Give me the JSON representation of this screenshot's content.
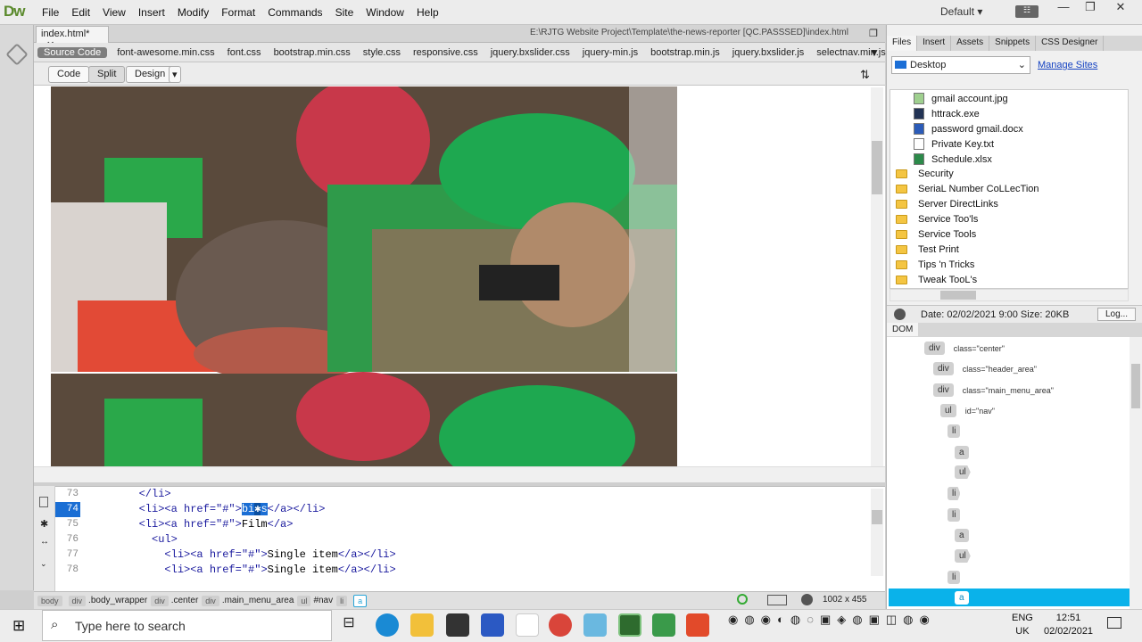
{
  "app": {
    "logo": "Dw",
    "workspace": "Default"
  },
  "menu": [
    "File",
    "Edit",
    "View",
    "Insert",
    "Modify",
    "Format",
    "Commands",
    "Site",
    "Window",
    "Help"
  ],
  "document": {
    "tab": "index.html*",
    "path": "E:\\RJTG Website Project\\Template\\the-news-reporter [QC.PASSSED]\\index.html"
  },
  "related_files": [
    "Source Code",
    "font-awesome.min.css",
    "font.css",
    "bootstrap.min.css",
    "style.css",
    "responsive.css",
    "jquery.bxslider.css",
    "jquery-min.js",
    "bootstrap.min.js",
    "jquery.bxslider.js",
    "selectnav.min.js"
  ],
  "view_buttons": {
    "code": "Code",
    "split": "Split",
    "design": "Design"
  },
  "code": {
    "line_numbers": [
      "73",
      "74",
      "75",
      "76",
      "77",
      "78"
    ],
    "lines": [
      {
        "indent": "        ",
        "text": "</li>"
      },
      {
        "indent": "        ",
        "pre": "<li><a href=\"#\">",
        "hl": "bi",
        "hl2": "s",
        "post": "</a></li>"
      },
      {
        "indent": "        ",
        "pre": "<li><a href=\"#\">",
        "mid": "Film",
        "post": "</a>"
      },
      {
        "indent": "          ",
        "text": "<ul>"
      },
      {
        "indent": "            ",
        "pre": "<li><a href=\"#\">",
        "mid": "Single item",
        "post": "</a></li>"
      },
      {
        "indent": "            ",
        "pre": "<li><a href=\"#\">",
        "mid": "Single item",
        "post": "</a></li>"
      }
    ]
  },
  "tag_selector": [
    {
      "tag": "body",
      "cls": ""
    },
    {
      "tag": "div",
      "cls": ".body_wrapper"
    },
    {
      "tag": "div",
      "cls": ".center"
    },
    {
      "tag": "div",
      "cls": ".main_menu_area"
    },
    {
      "tag": "ul",
      "cls": "#nav"
    },
    {
      "tag": "li",
      "cls": ""
    },
    {
      "tag": "a",
      "cls": ""
    }
  ],
  "window_size": "1002 x 455",
  "panels": {
    "tabs": [
      "Files",
      "Insert",
      "Assets",
      "Snippets",
      "CSS Designer"
    ],
    "site": "Desktop",
    "manage_sites": "Manage Sites",
    "files": [
      {
        "name": "gmail account.jpg",
        "type": "file"
      },
      {
        "name": "httrack.exe",
        "type": "file"
      },
      {
        "name": "password gmail.docx",
        "type": "file"
      },
      {
        "name": "Private Key.txt",
        "type": "file"
      },
      {
        "name": "Schedule.xlsx",
        "type": "file"
      },
      {
        "name": "Security",
        "type": "folder"
      },
      {
        "name": "SeriaL Number CoLLecTion",
        "type": "folder"
      },
      {
        "name": "Server DirectLinks",
        "type": "folder"
      },
      {
        "name": "Service Too'ls",
        "type": "folder"
      },
      {
        "name": "Service Tools",
        "type": "folder"
      },
      {
        "name": "Test Print",
        "type": "folder"
      },
      {
        "name": "Tips 'n Tricks",
        "type": "folder"
      },
      {
        "name": "Tweak TooL's",
        "type": "folder"
      }
    ],
    "status": "Date: 02/02/2021 9:00  Size: 20KB",
    "log_button": "Log...",
    "dom_title": "DOM",
    "dom": [
      {
        "tag": "div",
        "attr": "class=\"center\""
      },
      {
        "tag": "div",
        "attr": "class=\"header_area\""
      },
      {
        "tag": "div",
        "attr": "class=\"main_menu_area\""
      },
      {
        "tag": "ul",
        "attr": "id=\"nav\""
      },
      {
        "tag": "li",
        "attr": ""
      },
      {
        "tag": "a",
        "attr": ""
      },
      {
        "tag": "ul",
        "attr": ""
      },
      {
        "tag": "li",
        "attr": ""
      },
      {
        "tag": "li",
        "attr": ""
      },
      {
        "tag": "a",
        "attr": ""
      },
      {
        "tag": "ul",
        "attr": ""
      },
      {
        "tag": "li",
        "attr": ""
      },
      {
        "tag": "a",
        "attr": ""
      }
    ]
  },
  "taskbar": {
    "search_placeholder": "Type here to search",
    "lang1": "ENG",
    "lang2": "UK",
    "time": "12:51",
    "date": "02/02/2021"
  }
}
